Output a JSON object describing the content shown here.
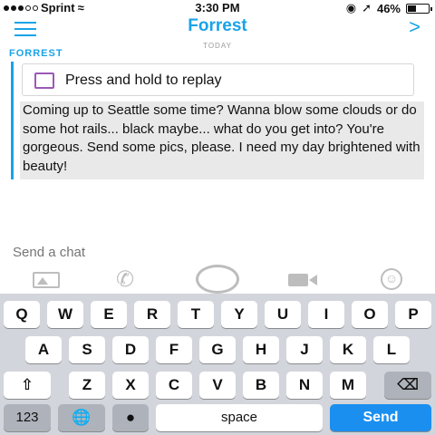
{
  "status_bar": {
    "carrier": "Sprint",
    "time": "3:30 PM",
    "battery": "46%",
    "battery_level": 0.46
  },
  "header": {
    "title": "Forrest",
    "forward_glyph": ">"
  },
  "conversation": {
    "day_label": "TODAY",
    "sender": "FORREST",
    "replay_label": "Press and hold to replay",
    "message": "Coming up to Seattle some time? Wanna blow some clouds or do some hot rails... black maybe... what do you get into? You're gorgeous. Send some pics, please. I need my day brightened with beauty!"
  },
  "compose": {
    "placeholder": "Send a chat"
  },
  "keyboard": {
    "row1": [
      "Q",
      "W",
      "E",
      "R",
      "T",
      "Y",
      "U",
      "I",
      "O",
      "P"
    ],
    "row2": [
      "A",
      "S",
      "D",
      "F",
      "G",
      "H",
      "J",
      "K",
      "L"
    ],
    "row3": [
      "Z",
      "X",
      "C",
      "V",
      "B",
      "N",
      "M"
    ],
    "numbers": "123",
    "space": "space",
    "send": "Send"
  },
  "colors": {
    "accent": "#1aa3e8",
    "send_key": "#1a8ff0",
    "replay_box": "#9b59b6"
  },
  "icons": {
    "menu": "menu-icon",
    "gallery": "photo-icon",
    "call": "phone-icon",
    "capture": "capture-icon",
    "video": "video-icon",
    "sticker": "sticker-icon",
    "shift": "shift-icon",
    "delete": "backspace-icon",
    "globe": "globe-icon",
    "mic": "mic-icon"
  }
}
